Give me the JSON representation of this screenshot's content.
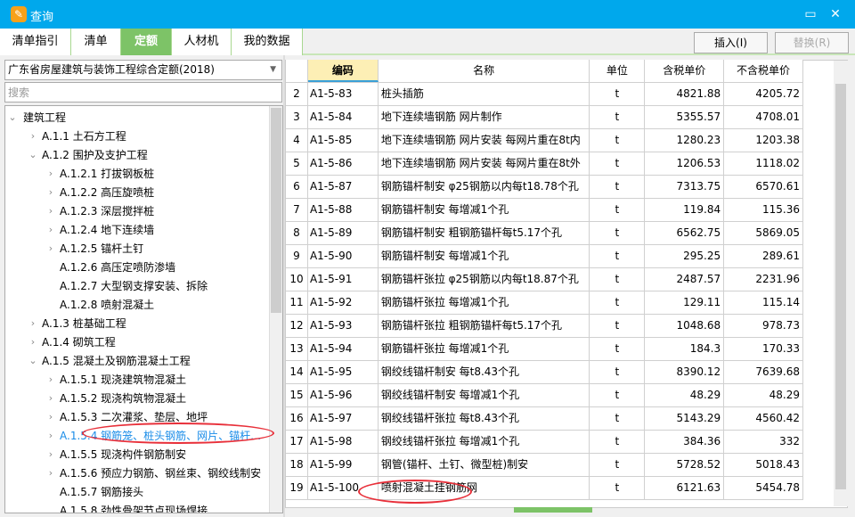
{
  "window": {
    "title": "查询",
    "icon": "app-logo-icon",
    "minimize_icon": "minimize-icon",
    "close_icon": "close-icon"
  },
  "tabs": [
    "清单指引",
    "清单",
    "定额",
    "人材机",
    "我的数据"
  ],
  "active_tab": 2,
  "buttons": {
    "insert": "插入(I)",
    "replace": "替换(R)"
  },
  "library": "广东省房屋建筑与装饰工程综合定额(2018)",
  "search_placeholder": "搜索",
  "tree": [
    {
      "label": "建筑工程",
      "level": 0,
      "state": "expanded"
    },
    {
      "label": "A.1.1 土石方工程",
      "level": 1,
      "state": "collapsed"
    },
    {
      "label": "A.1.2 围护及支护工程",
      "level": 1,
      "state": "expanded"
    },
    {
      "label": "A.1.2.1 打拔钢板桩",
      "level": 2,
      "state": "collapsed"
    },
    {
      "label": "A.1.2.2 高压旋喷桩",
      "level": 2,
      "state": "collapsed"
    },
    {
      "label": "A.1.2.3 深层搅拌桩",
      "level": 2,
      "state": "collapsed"
    },
    {
      "label": "A.1.2.4 地下连续墙",
      "level": 2,
      "state": "collapsed"
    },
    {
      "label": "A.1.2.5 锚杆土钉",
      "level": 2,
      "state": "collapsed"
    },
    {
      "label": "A.1.2.6 高压定喷防渗墙",
      "level": 2,
      "state": "leaf"
    },
    {
      "label": "A.1.2.7 大型钢支撑安装、拆除",
      "level": 2,
      "state": "leaf"
    },
    {
      "label": "A.1.2.8 喷射混凝土",
      "level": 2,
      "state": "leaf"
    },
    {
      "label": "A.1.3 桩基础工程",
      "level": 1,
      "state": "collapsed"
    },
    {
      "label": "A.1.4 砌筑工程",
      "level": 1,
      "state": "collapsed"
    },
    {
      "label": "A.1.5 混凝土及钢筋混凝土工程",
      "level": 1,
      "state": "expanded"
    },
    {
      "label": "A.1.5.1 现浇建筑物混凝土",
      "level": 2,
      "state": "collapsed"
    },
    {
      "label": "A.1.5.2 现浇构筑物混凝土",
      "level": 2,
      "state": "collapsed"
    },
    {
      "label": "A.1.5.3 二次灌浆、垫层、地坪",
      "level": 2,
      "state": "collapsed"
    },
    {
      "label": "A.1.5.4 钢筋笼、桩头钢筋、网片、锚杆…",
      "level": 2,
      "state": "collapsed",
      "selected": true
    },
    {
      "label": "A.1.5.5 现浇构件钢筋制安",
      "level": 2,
      "state": "collapsed"
    },
    {
      "label": "A.1.5.6 预应力钢筋、钢丝束、钢绞线制安",
      "level": 2,
      "state": "collapsed"
    },
    {
      "label": "A.1.5.7 钢筋接头",
      "level": 2,
      "state": "leaf"
    },
    {
      "label": "A.1.5.8 劲性骨架节点现场焊接",
      "level": 2,
      "state": "leaf"
    }
  ],
  "table": {
    "headers": [
      "",
      "编码",
      "名称",
      "单位",
      "含税单价",
      "不含税单价"
    ],
    "rows": [
      [
        "2",
        "A1-5-83",
        "桩头插筋",
        "t",
        "4821.88",
        "4205.72"
      ],
      [
        "3",
        "A1-5-84",
        "地下连续墙钢筋 网片制作",
        "t",
        "5355.57",
        "4708.01"
      ],
      [
        "4",
        "A1-5-85",
        "地下连续墙钢筋 网片安装 每网片重在8t内",
        "t",
        "1280.23",
        "1203.38"
      ],
      [
        "5",
        "A1-5-86",
        "地下连续墙钢筋 网片安装 每网片重在8t外",
        "t",
        "1206.53",
        "1118.02"
      ],
      [
        "6",
        "A1-5-87",
        "钢筋锚杆制安 φ25钢筋以内每t18.78个孔",
        "t",
        "7313.75",
        "6570.61"
      ],
      [
        "7",
        "A1-5-88",
        "钢筋锚杆制安 每增减1个孔",
        "t",
        "119.84",
        "115.36"
      ],
      [
        "8",
        "A1-5-89",
        "钢筋锚杆制安 粗钢筋锚杆每t5.17个孔",
        "t",
        "6562.75",
        "5869.05"
      ],
      [
        "9",
        "A1-5-90",
        "钢筋锚杆制安 每增减1个孔",
        "t",
        "295.25",
        "289.61"
      ],
      [
        "10",
        "A1-5-91",
        "钢筋锚杆张拉 φ25钢筋以内每t18.87个孔",
        "t",
        "2487.57",
        "2231.96"
      ],
      [
        "11",
        "A1-5-92",
        "钢筋锚杆张拉 每增减1个孔",
        "t",
        "129.11",
        "115.14"
      ],
      [
        "12",
        "A1-5-93",
        "钢筋锚杆张拉 粗钢筋锚杆每t5.17个孔",
        "t",
        "1048.68",
        "978.73"
      ],
      [
        "13",
        "A1-5-94",
        "钢筋锚杆张拉 每增减1个孔",
        "t",
        "184.3",
        "170.33"
      ],
      [
        "14",
        "A1-5-95",
        "钢绞线锚杆制安 每t8.43个孔",
        "t",
        "8390.12",
        "7639.68"
      ],
      [
        "15",
        "A1-5-96",
        "钢绞线锚杆制安 每增减1个孔",
        "t",
        "48.29",
        "48.29"
      ],
      [
        "16",
        "A1-5-97",
        "钢绞线锚杆张拉 每t8.43个孔",
        "t",
        "5143.29",
        "4560.42"
      ],
      [
        "17",
        "A1-5-98",
        "钢绞线锚杆张拉 每增减1个孔",
        "t",
        "384.36",
        "332"
      ],
      [
        "18",
        "A1-5-99",
        "钢管(锚杆、土钉、微型桩)制安",
        "t",
        "5728.52",
        "5018.43"
      ],
      [
        "19",
        "A1-5-100",
        "喷射混凝土挂钢筋网",
        "t",
        "6121.63",
        "5454.78"
      ]
    ]
  },
  "colors": {
    "titlebar": "#00a8ec",
    "active_tab": "#7dc367",
    "selected_tree": "#1a8ce8",
    "annotation": "#e8303a"
  }
}
